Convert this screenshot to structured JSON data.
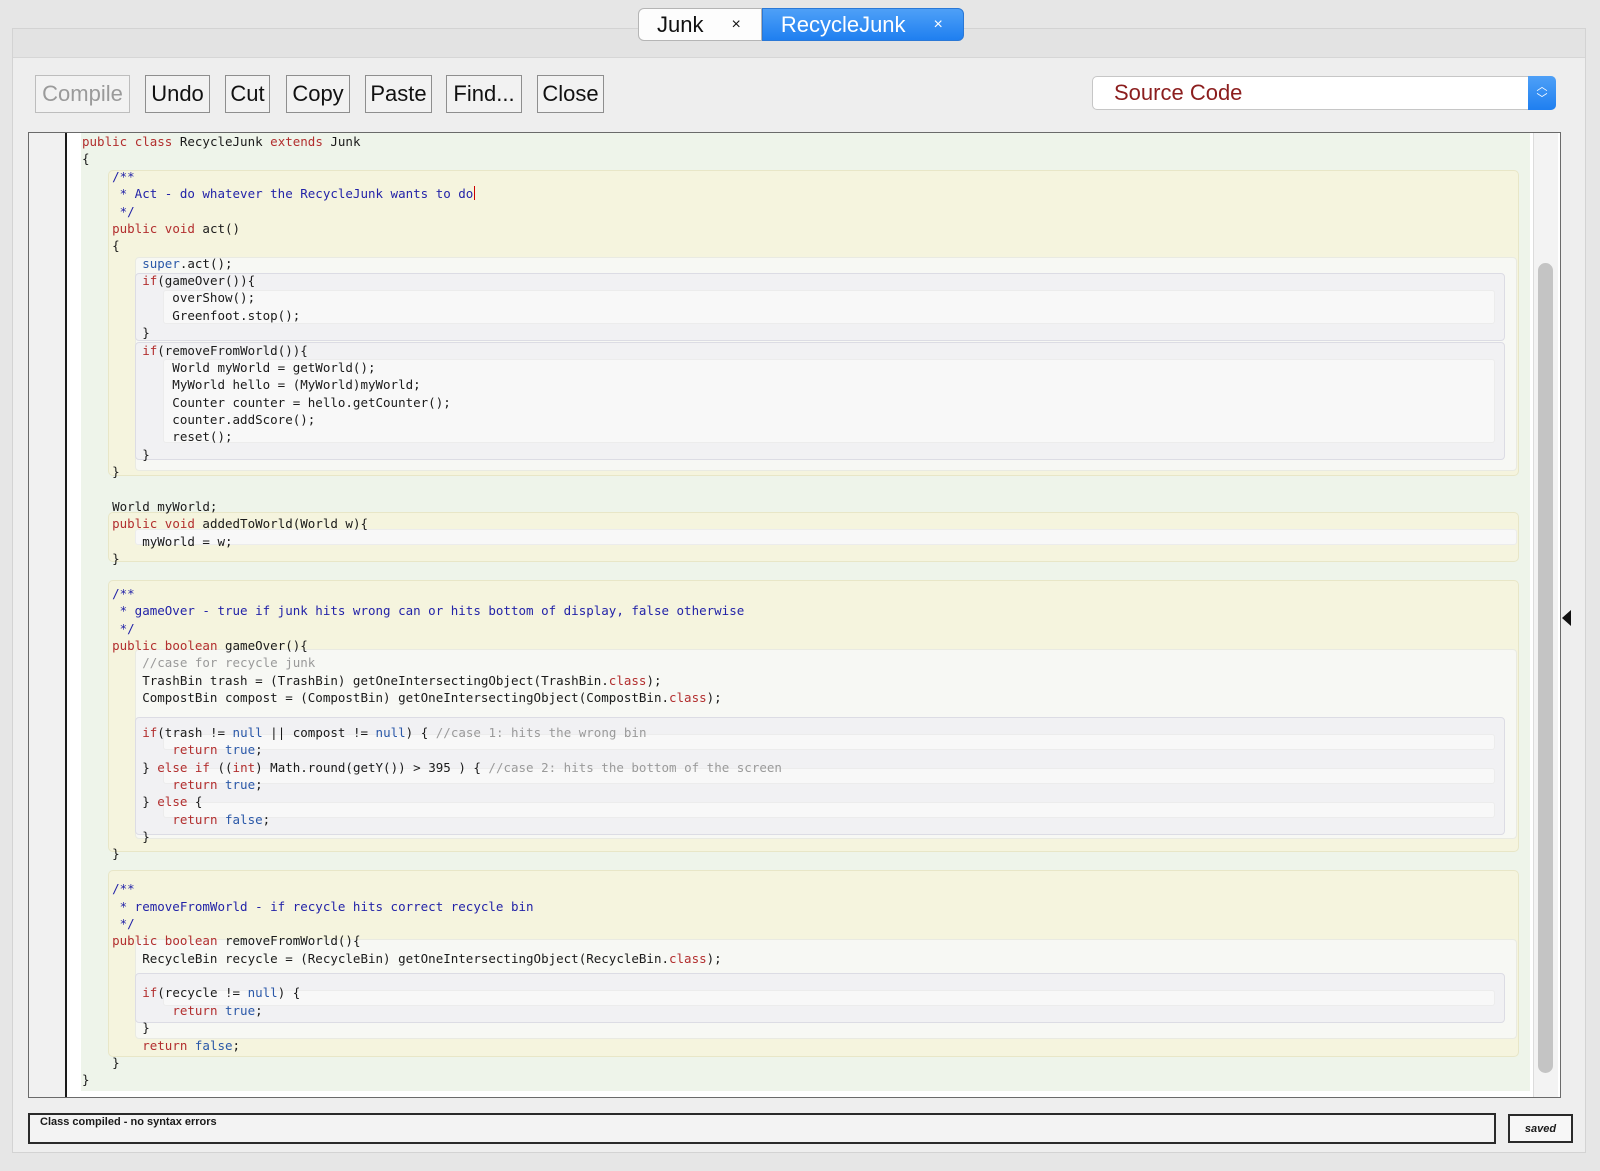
{
  "tabs": [
    {
      "label": "Junk",
      "close": "×"
    },
    {
      "label": "RecycleJunk",
      "close": "×"
    }
  ],
  "toolbar": {
    "compile": "Compile",
    "undo": "Undo",
    "cut": "Cut",
    "copy": "Copy",
    "paste": "Paste",
    "find": "Find...",
    "close": "Close"
  },
  "view_select": {
    "value": "Source Code",
    "arrow_up": "︿",
    "arrow_down": "﹀"
  },
  "code_lines": [
    "public class RecycleJunk extends Junk",
    "{",
    "    /**",
    "     * Act - do whatever the RecycleJunk wants to do",
    "     */",
    "    public void act()",
    "    {",
    "        super.act();",
    "        if(gameOver()){",
    "            overShow();",
    "            Greenfoot.stop();",
    "        }",
    "        if(removeFromWorld()){",
    "            World myWorld = getWorld();",
    "            MyWorld hello = (MyWorld)myWorld;",
    "            Counter counter = hello.getCounter();",
    "            counter.addScore();",
    "            reset();",
    "        }",
    "    }",
    "",
    "    World myWorld;",
    "    public void addedToWorld(World w){",
    "        myWorld = w;",
    "    }",
    "",
    "    /**",
    "     * gameOver - true if junk hits wrong can or hits bottom of display, false otherwise",
    "     */",
    "    public boolean gameOver(){",
    "        //case for recycle junk",
    "        TrashBin trash = (TrashBin) getOneIntersectingObject(TrashBin.class);",
    "        CompostBin compost = (CompostBin) getOneIntersectingObject(CompostBin.class);",
    "",
    "        if(trash != null || compost != null) { //case 1: hits the wrong bin",
    "            return true;",
    "        } else if ((int) Math.round(getY()) > 395 ) { //case 2: hits the bottom of the screen",
    "            return true;",
    "        } else {",
    "            return false;",
    "        }",
    "    }",
    "",
    "    /**",
    "     * removeFromWorld - if recycle hits correct recycle bin",
    "     */",
    "    public boolean removeFromWorld(){",
    "        RecycleBin recycle = (RecycleBin) getOneIntersectingObject(RecycleBin.class);",
    "",
    "        if(recycle != null) {",
    "            return true;",
    "        }",
    "        return false;",
    "    }",
    "}"
  ],
  "status_message": "Class compiled - no syntax errors",
  "saved_label": "saved",
  "colors": {
    "keyword": "#b22e2e",
    "literal": "#2a58a8",
    "javadoc": "#2323a8",
    "comment": "#9a9a9a",
    "accent": "#1f7ff0"
  },
  "icons": [
    "close-tab-icon",
    "select-arrows-icon",
    "panel-toggle-arrow-icon"
  ]
}
